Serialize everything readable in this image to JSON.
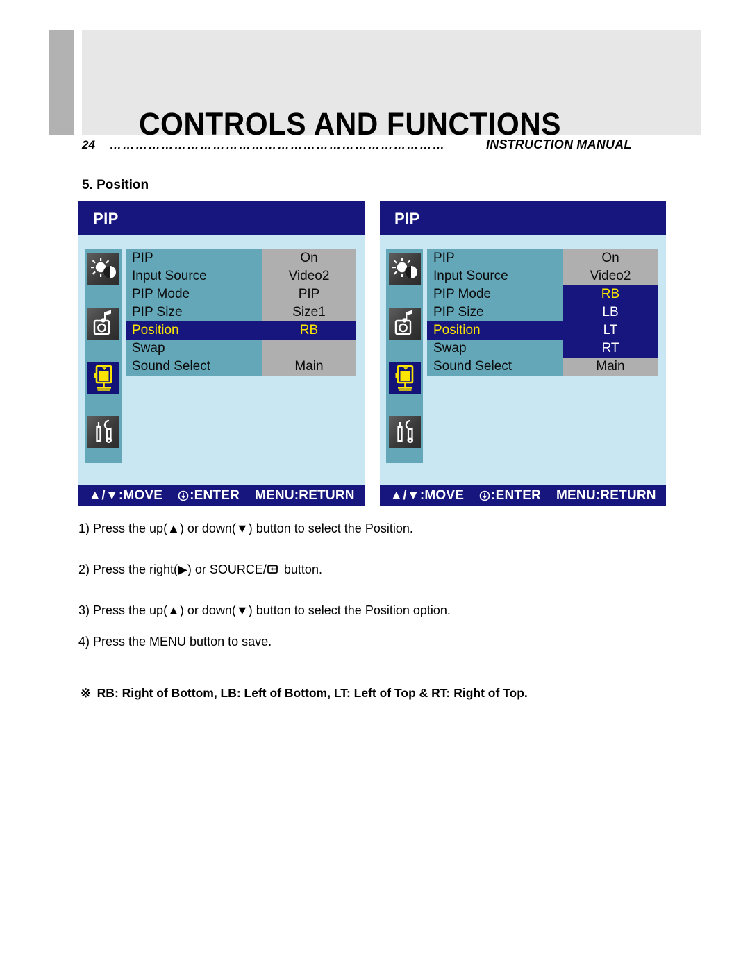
{
  "header": {
    "title": "CONTROLS AND FUNCTIONS",
    "page_number": "24",
    "dotted_leader": "……………………………………………………………………",
    "manual_label": "INSTRUCTION MANUAL"
  },
  "section": {
    "heading": "5. Position"
  },
  "osd_left": {
    "title": "PIP",
    "sidebar_icons": [
      "brightness-contrast-icon",
      "audio-icon",
      "pip-screen-icon",
      "setup-tools-icon"
    ],
    "active_icon_index": 2,
    "rows": [
      {
        "label": "PIP",
        "value": "On",
        "selected": false
      },
      {
        "label": "Input Source",
        "value": "Video2",
        "selected": false
      },
      {
        "label": "PIP Mode",
        "value": "PIP",
        "selected": false
      },
      {
        "label": "PIP Size",
        "value": "Size1",
        "selected": false
      },
      {
        "label": "Position",
        "value": "RB",
        "selected": true
      },
      {
        "label": "Swap",
        "value": "",
        "selected": false
      },
      {
        "label": "Sound Select",
        "value": "Main",
        "selected": false
      }
    ],
    "footer": {
      "move": "▲/▼:MOVE",
      "enter": ":ENTER",
      "return": "MENU:RETURN"
    }
  },
  "osd_right": {
    "title": "PIP",
    "sidebar_icons": [
      "brightness-contrast-icon",
      "audio-icon",
      "pip-screen-icon",
      "setup-tools-icon"
    ],
    "active_icon_index": 2,
    "rows": [
      {
        "label": "PIP",
        "value": "On",
        "label_selected": false,
        "value_option": false,
        "value_current": false
      },
      {
        "label": "Input Source",
        "value": "Video2",
        "label_selected": false,
        "value_option": false,
        "value_current": false
      },
      {
        "label": "PIP Mode",
        "value": "RB",
        "label_selected": false,
        "value_option": true,
        "value_current": true
      },
      {
        "label": "PIP Size",
        "value": "LB",
        "label_selected": false,
        "value_option": true,
        "value_current": false
      },
      {
        "label": "Position",
        "value": "LT",
        "label_selected": true,
        "value_option": true,
        "value_current": false
      },
      {
        "label": "Swap",
        "value": "RT",
        "label_selected": false,
        "value_option": true,
        "value_current": false
      },
      {
        "label": "Sound Select",
        "value": "Main",
        "label_selected": false,
        "value_option": false,
        "value_current": false
      }
    ],
    "footer": {
      "move": "▲/▼:MOVE",
      "enter": ":ENTER",
      "return": "MENU:RETURN"
    }
  },
  "steps": {
    "step1": "1) Press the up(▲) or down(▼) button to select the Position.",
    "step2_before": "2) Press the right(▶) or SOURCE/",
    "step2_after": "button.",
    "step3": "3) Press the up(▲) or down(▼) button to select the Position option.",
    "step4": "4) Press the MENU button to save."
  },
  "footnote": {
    "marker": "※",
    "text": "RB: Right of Bottom, LB: Left of Bottom, LT: Left of Top & RT: Right of Top."
  },
  "colors": {
    "osd_navy": "#16167e",
    "osd_body": "#c9e7f2",
    "osd_label_bg": "#64a7b8",
    "osd_value_bg": "#afafaf",
    "highlight_text": "#fbe500",
    "header_block": "#e7e7e7",
    "header_accent": "#b2b2b2"
  }
}
